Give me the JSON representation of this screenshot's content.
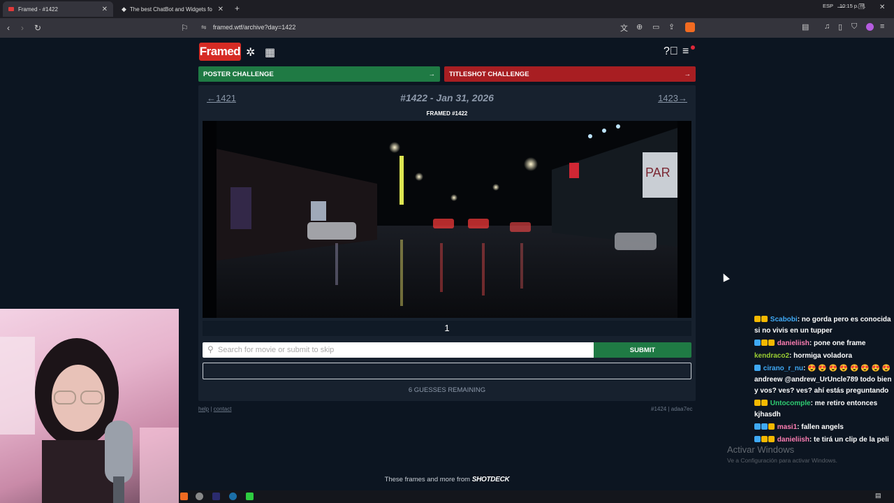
{
  "browser": {
    "tabs": [
      {
        "label": "Framed - #1422",
        "active": true
      },
      {
        "label": "The best ChatBot and Widgets fo",
        "active": false
      }
    ],
    "new_tab": "+",
    "url": "framed.wtf/archive?day=1422",
    "window_controls": [
      "minimize-icon",
      "restore-icon",
      "close-icon"
    ]
  },
  "header": {
    "logo": "Framed",
    "icons": [
      "puzzle-icon",
      "calendar-icon",
      "help-icon",
      "menu-icon"
    ]
  },
  "challenges": {
    "poster_label": "POSTER CHALLENGE",
    "titleshot_label": "TITLESHOT CHALLENGE",
    "arrow": "→",
    "poster_color": "#1f7a44",
    "titleshot_color": "#a81e22"
  },
  "archive": {
    "prev": "←1421",
    "title": "#1422 - Jan 31, 2026",
    "next": "1423→",
    "frame_label": "FRAMED #1422",
    "page_number": "1",
    "search_placeholder": "Search for movie or submit to skip",
    "search_value": "",
    "submit_label": "SUBMIT",
    "guesses_remaining": "6 GUESSES REMAINING",
    "frame_sign_text": "PAR"
  },
  "footer": {
    "help": "help",
    "separator": "|",
    "contact": "contact",
    "build": "#1424 | adaa7ec"
  },
  "credit": {
    "text": "These frames and more from",
    "brand": "SHOTDECK"
  },
  "stream": {
    "chat": [
      {
        "user": "Scabobi",
        "color": "#3fa9f5",
        "text": ": no gorda pero es conocida si no vivis en un tupper"
      },
      {
        "user": "danieliish",
        "color": "#ff7eb3",
        "text": ": pone one frame"
      },
      {
        "user": "kendraco2",
        "color": "#9acd32",
        "text": ": hormiga voladora"
      },
      {
        "user": "cirano_r_nu",
        "color": "#3fa9f5",
        "text": ": 😍 😍 😍 😍 😍 😍 😍 😍 andreew @andrew_UrUncle789 todo bien y vos? ves? ves? ahí estás preguntando"
      },
      {
        "user": "Untocomple",
        "color": "#2ecc71",
        "text": ": me retiro entonces kjhasdh"
      },
      {
        "user": "masi1",
        "color": "#ff7eb3",
        "text": ": fallen angels"
      },
      {
        "user": "danieliish",
        "color": "#ff7eb3",
        "text": ": te tirá un clip de la peli"
      }
    ],
    "watermark_title": "Activar Windows",
    "watermark_sub": "Ve a Configuración para activar Windows."
  },
  "taskbar": {
    "lang": "ESP",
    "time": "10:15 p. m."
  }
}
